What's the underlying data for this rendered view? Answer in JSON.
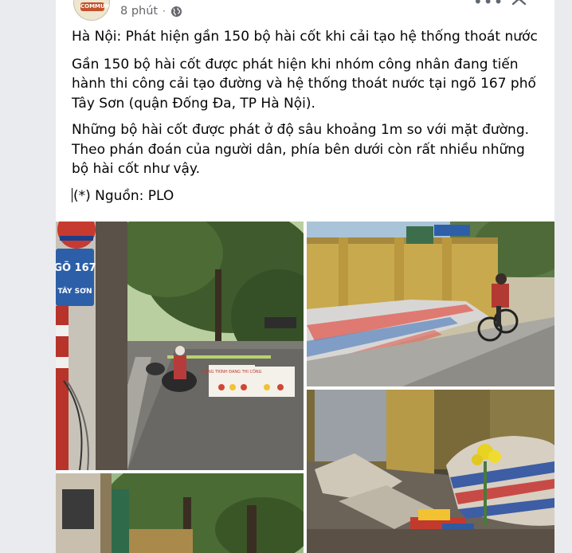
{
  "post": {
    "time": "8 phút",
    "separator": "·",
    "privacy_icon": "globe-icon",
    "more_icon": "ellipsis-icon",
    "close_icon": "close-icon",
    "avatar_text": "COMMUNE",
    "title": "Hà Nội: Phát hiện gần 150 bộ hài cốt khi cải tạo hệ thống thoát nước",
    "paragraph1": "Gần 150 bộ hài cốt được phát hiện khi nhóm công nhân đang tiến hành thi công cải tạo đường và hệ thống thoát nước tại ngõ 167 phố Tây Sơn (quận Đống Đa, TP Hà Nội).",
    "paragraph2": "Những bộ hài cốt được phát ở độ sâu khoảng 1m so với mặt đường. Theo phán đoán của người dân, phía bên dưới còn rất nhiều những bộ hài cốt như vậy.",
    "source": "(*) Nguồn: PLO"
  },
  "photos": {
    "street_sign_line1": "GÕ 167",
    "street_sign_line2": "TÂY SƠN",
    "barrier_sign_title": "CÔNG TRÌNH ĐANG THI CÔNG"
  },
  "colors": {
    "text": "#050505",
    "meta": "#65676b",
    "background": "#e9ebee"
  }
}
